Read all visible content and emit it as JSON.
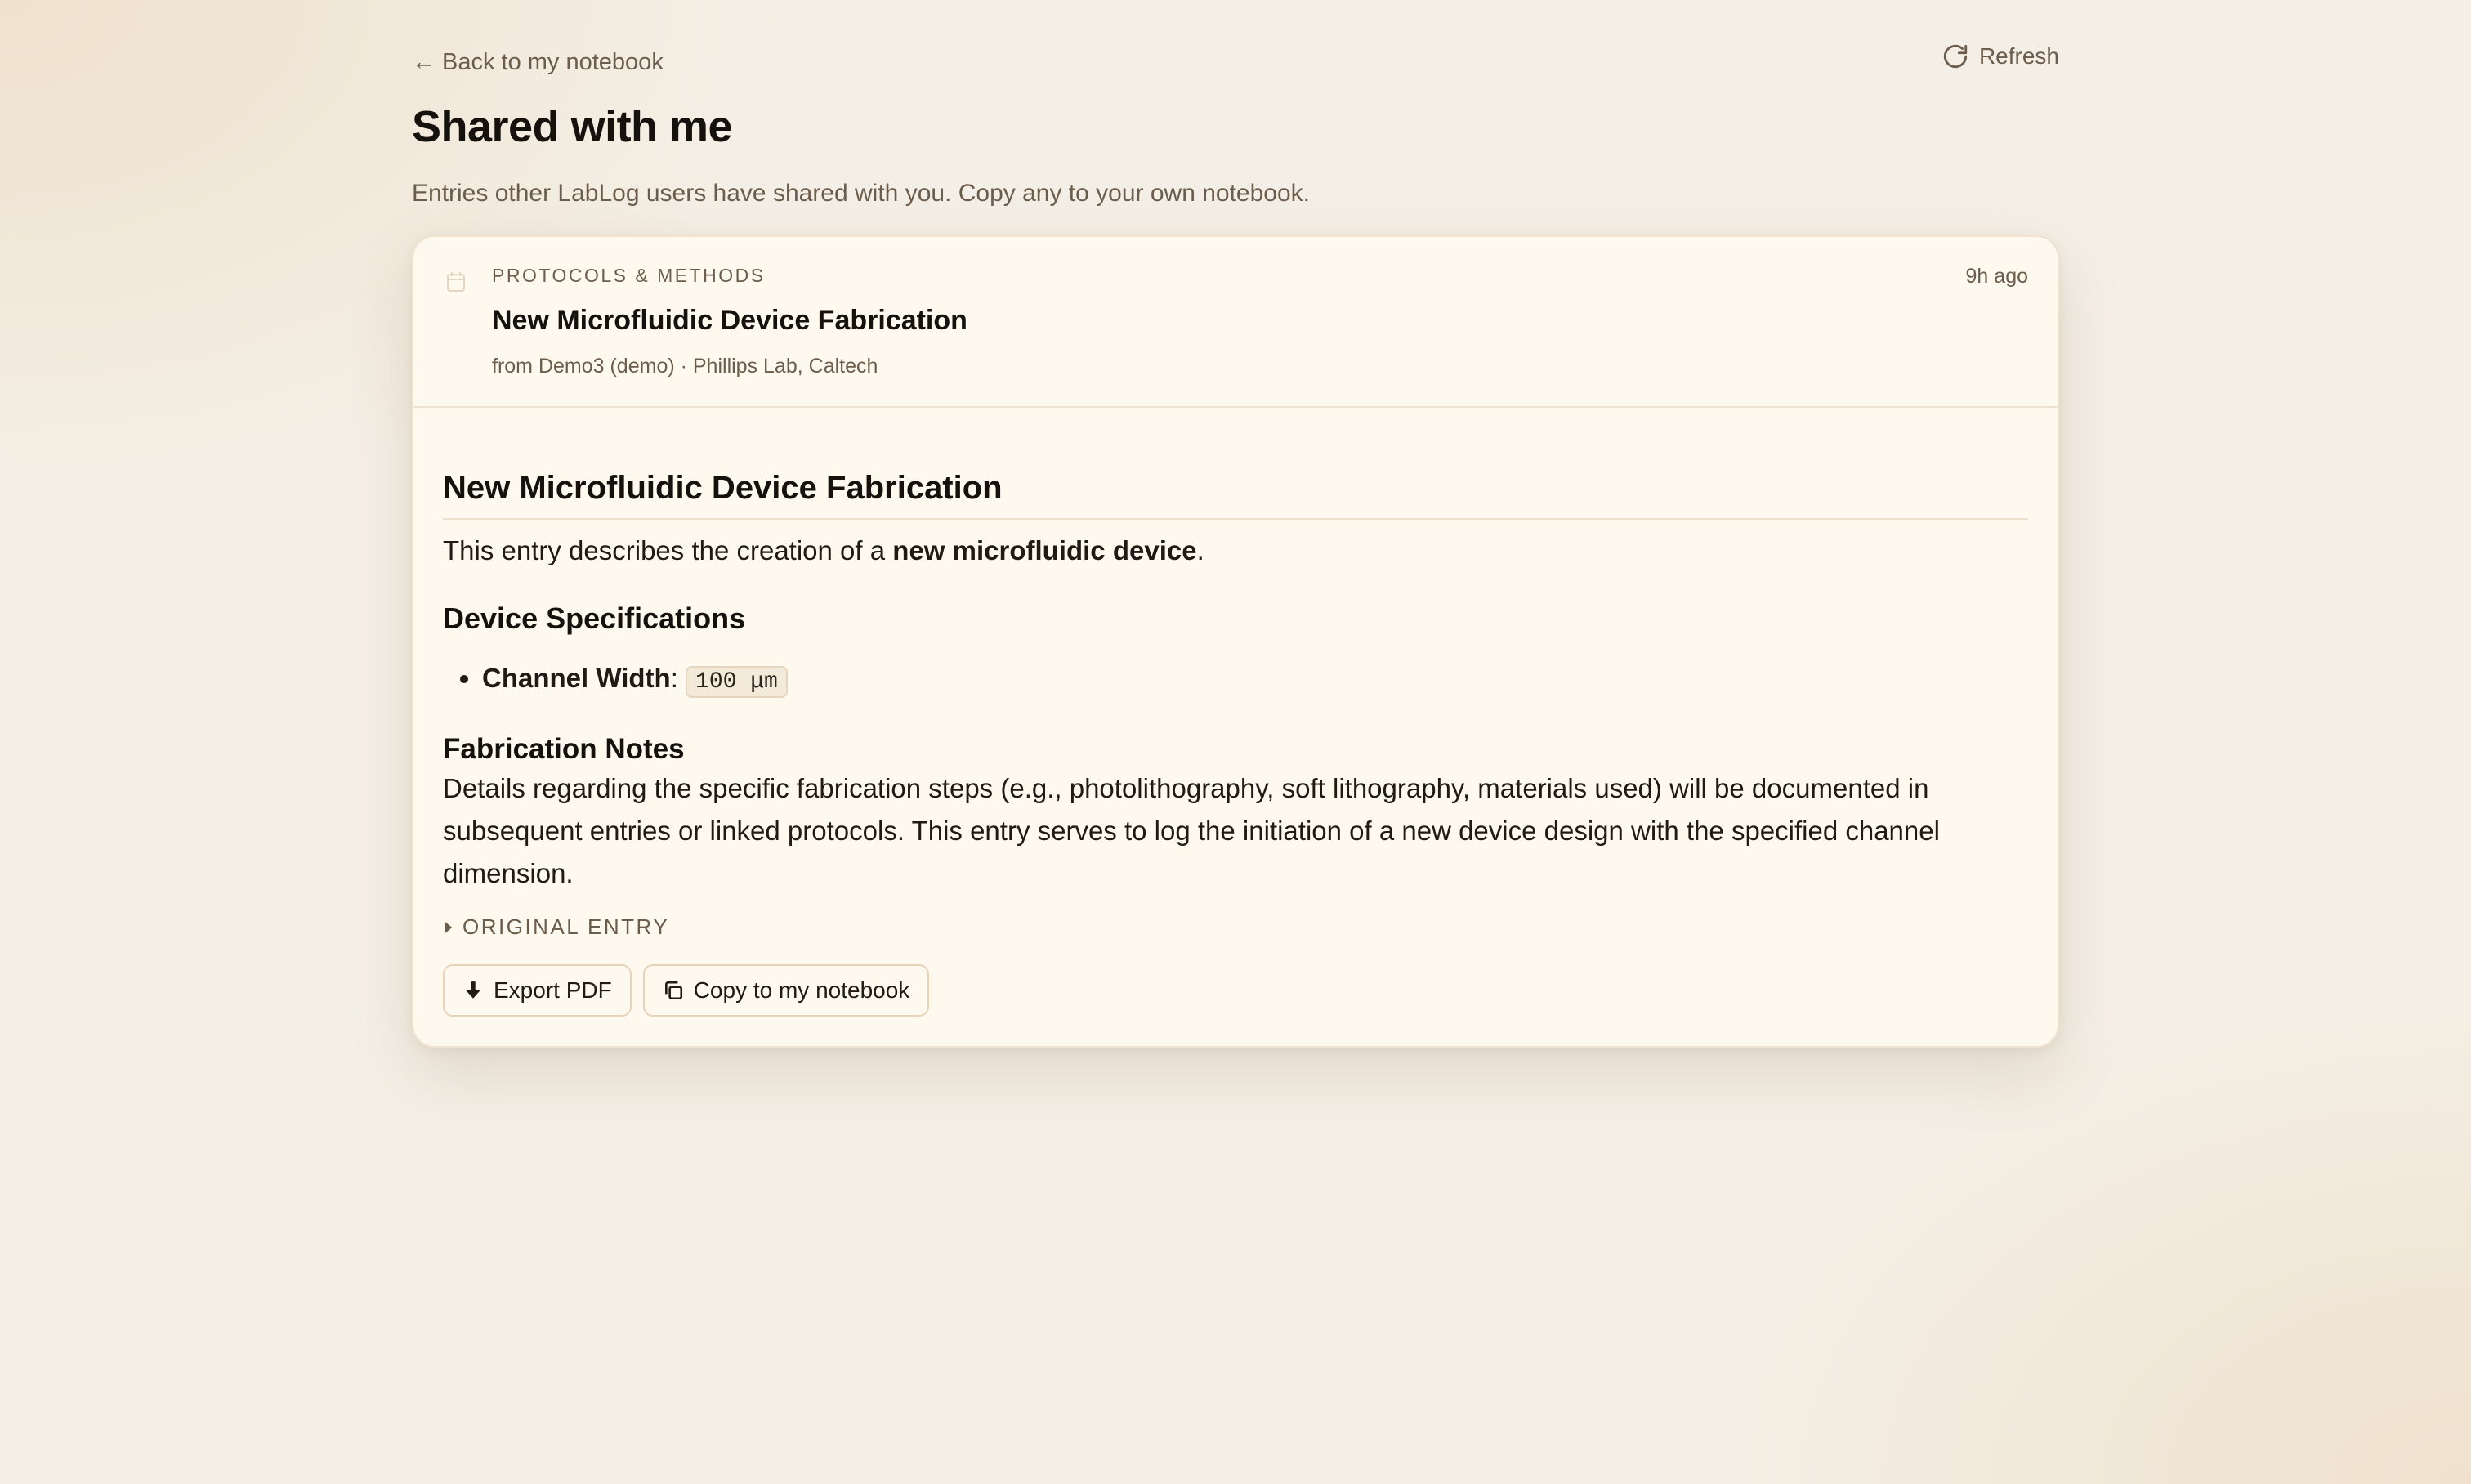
{
  "nav": {
    "back_label": "Back to my notebook",
    "back_arrow": "←",
    "refresh_label": "Refresh"
  },
  "page": {
    "title": "Shared with me",
    "subtitle": "Entries other LabLog users have shared with you. Copy any to your own notebook."
  },
  "entry": {
    "category": "PROTOCOLS & METHODS",
    "title": "New Microfluidic Device Fabrication",
    "source": "from Demo3 (demo) · Phillips Lab, Caltech",
    "timestamp": "9h ago",
    "body": {
      "heading": "New Microfluidic Device Fabrication",
      "intro_prefix": "This entry describes the creation of a ",
      "intro_bold": "new microfluidic device",
      "intro_suffix": ".",
      "specs_heading": "Device Specifications",
      "spec_items": [
        {
          "label": "Channel Width",
          "separator": ":",
          "value": "100 μm"
        }
      ],
      "notes_heading": "Fabrication Notes",
      "notes_text": "Details regarding the specific fabrication steps (e.g., photolithography, soft lithography, materials used) will be documented in subsequent entries or linked protocols. This entry serves to log the initiation of a new device design with the specified channel dimension."
    },
    "original_toggle_label": "ORIGINAL ENTRY",
    "actions": {
      "export_label": "Export PDF",
      "copy_label": "Copy to my notebook"
    }
  },
  "icons": {
    "refresh": "refresh-icon",
    "entry": "calendar-icon",
    "toggle": "caret-right-icon",
    "export": "download-icon",
    "copy": "copy-icon"
  },
  "colors": {
    "background": "#f4efe6",
    "card": "#fdf9ee",
    "muted_text": "#6b5c4b",
    "border": "#efe1cc"
  }
}
